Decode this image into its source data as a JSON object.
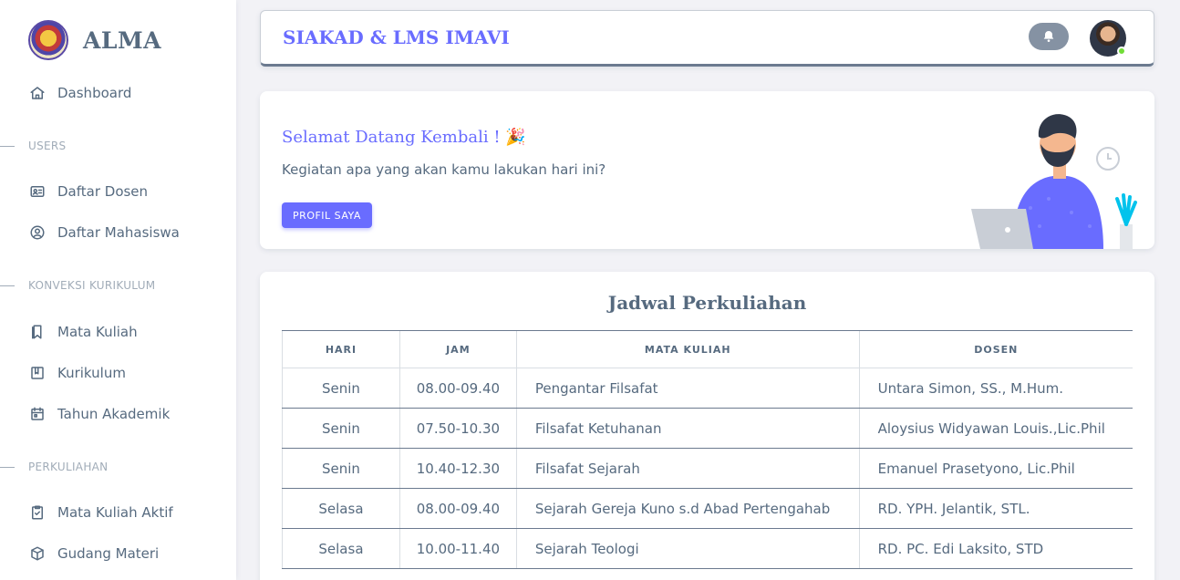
{
  "brand": {
    "name": "ALMA",
    "logo_icon": "university-seal-logo"
  },
  "sidebar": {
    "dashboard": {
      "label": "Dashboard",
      "icon": "home-icon"
    },
    "sections": [
      {
        "label": "USERS"
      },
      {
        "label": "KONVEKSI KURIKULUM"
      },
      {
        "label": "PERKULIAHAN"
      }
    ],
    "items": [
      {
        "label": "Daftar Dosen",
        "icon": "id-card-icon"
      },
      {
        "label": "Daftar Mahasiswa",
        "icon": "user-circle-icon"
      },
      {
        "label": "Mata Kuliah",
        "icon": "bookmark-icon"
      },
      {
        "label": "Kurikulum",
        "icon": "book-icon"
      },
      {
        "label": "Tahun Akademik",
        "icon": "calendar-icon"
      },
      {
        "label": "Mata Kuliah Aktif",
        "icon": "clipboard-check-icon"
      },
      {
        "label": "Gudang Materi",
        "icon": "package-icon"
      }
    ]
  },
  "navbar": {
    "title": "SIAKAD & LMS IMAVI",
    "online_status_color": "#71dd37"
  },
  "welcome": {
    "title": "Selamat Datang Kembali ! 🎉",
    "subtitle": "Kegiatan apa yang akan kamu lakukan hari ini?",
    "button_label": "PROFIL SAYA"
  },
  "schedule": {
    "title": "Jadwal Perkuliahan",
    "headers": [
      "HARI",
      "JAM",
      "MATA KULIAH",
      "DOSEN"
    ],
    "rows": [
      {
        "hari": "Senin",
        "jam": "08.00-09.40",
        "mata_kuliah": "Pengantar Filsafat",
        "dosen": "Untara Simon, SS., M.Hum."
      },
      {
        "hari": "Senin",
        "jam": "07.50-10.30",
        "mata_kuliah": "Filsafat Ketuhanan",
        "dosen": "Aloysius Widyawan Louis.,Lic.Phil"
      },
      {
        "hari": "Senin",
        "jam": "10.40-12.30",
        "mata_kuliah": "Filsafat Sejarah",
        "dosen": "Emanuel Prasetyono, Lic.Phil"
      },
      {
        "hari": "Selasa",
        "jam": "08.00-09.40",
        "mata_kuliah": "Sejarah Gereja Kuno s.d Abad Pertengahab",
        "dosen": "RD. YPH. Jelantik, STL."
      },
      {
        "hari": "Selasa",
        "jam": "10.00-11.40",
        "mata_kuliah": "Sejarah Teologi",
        "dosen": "RD. PC. Edi Laksito, STD"
      }
    ]
  },
  "colors": {
    "primary": "#696cff",
    "text": "#566a7f",
    "muted": "#a1acb8",
    "bell_bg": "#8592a3"
  }
}
